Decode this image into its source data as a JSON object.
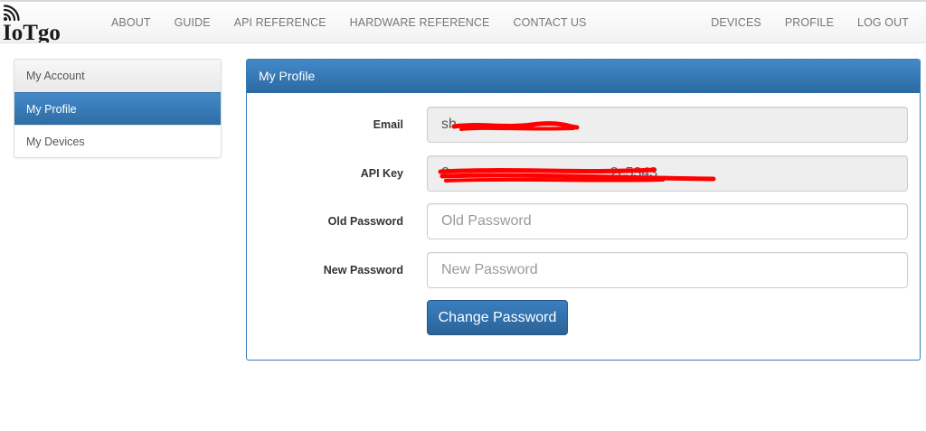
{
  "brand": {
    "name": "IoTgo",
    "logo_icon": "wifi-signal-icon"
  },
  "nav": {
    "left": [
      "ABOUT",
      "GUIDE",
      "API REFERENCE",
      "HARDWARE REFERENCE",
      "CONTACT US"
    ],
    "right": [
      "DEVICES",
      "PROFILE",
      "LOG OUT"
    ]
  },
  "sidebar": {
    "items": [
      {
        "label": "My Account"
      },
      {
        "label": "My Profile"
      },
      {
        "label": "My Devices"
      }
    ]
  },
  "panel": {
    "title": "My Profile",
    "email": {
      "label": "Email",
      "value": "sh"
    },
    "api_key": {
      "label": "API Key",
      "value": "2                                        2c5343"
    },
    "old_password": {
      "label": "Old Password",
      "placeholder": "Old Password"
    },
    "new_password": {
      "label": "New Password",
      "placeholder": "New Password"
    },
    "submit_label": "Change Password"
  },
  "colors": {
    "primary": "#337ab7",
    "primary_dark": "#2c6aa3",
    "redaction": "#ff0000",
    "readonly_bg": "#eeeeee"
  }
}
